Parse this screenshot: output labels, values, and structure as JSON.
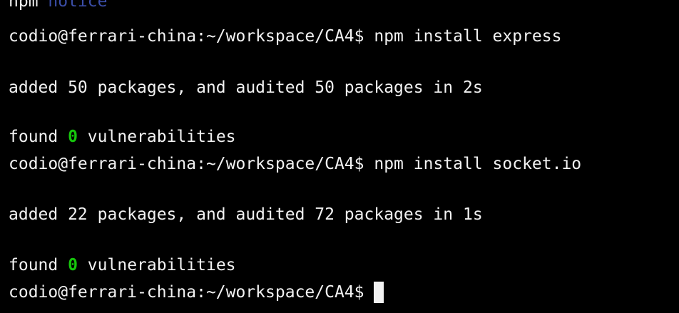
{
  "terminal": {
    "top_partial": {
      "prefix": "npm ",
      "notice": "notice"
    },
    "lines": [
      {
        "kind": "command",
        "prompt": "codio@ferrari-china:~/workspace/CA4$ ",
        "command": "npm install express"
      },
      {
        "kind": "output",
        "text": "added 50 packages, and audited 50 packages in 2s"
      },
      {
        "kind": "found",
        "pre": "found ",
        "count": "0",
        "post": " vulnerabilities"
      },
      {
        "kind": "command",
        "prompt": "codio@ferrari-china:~/workspace/CA4$ ",
        "command": "npm install socket.io"
      },
      {
        "kind": "output",
        "text": "added 22 packages, and audited 72 packages in 1s"
      },
      {
        "kind": "found",
        "pre": "found ",
        "count": "0",
        "post": " vulnerabilities"
      },
      {
        "kind": "prompt",
        "prompt": "codio@ferrari-china:~/workspace/CA4$ "
      }
    ],
    "colors": {
      "background": "#000000",
      "text": "#f2f2f2",
      "count_green": "#16c60c",
      "notice_blue": "#3b4ea8"
    }
  }
}
